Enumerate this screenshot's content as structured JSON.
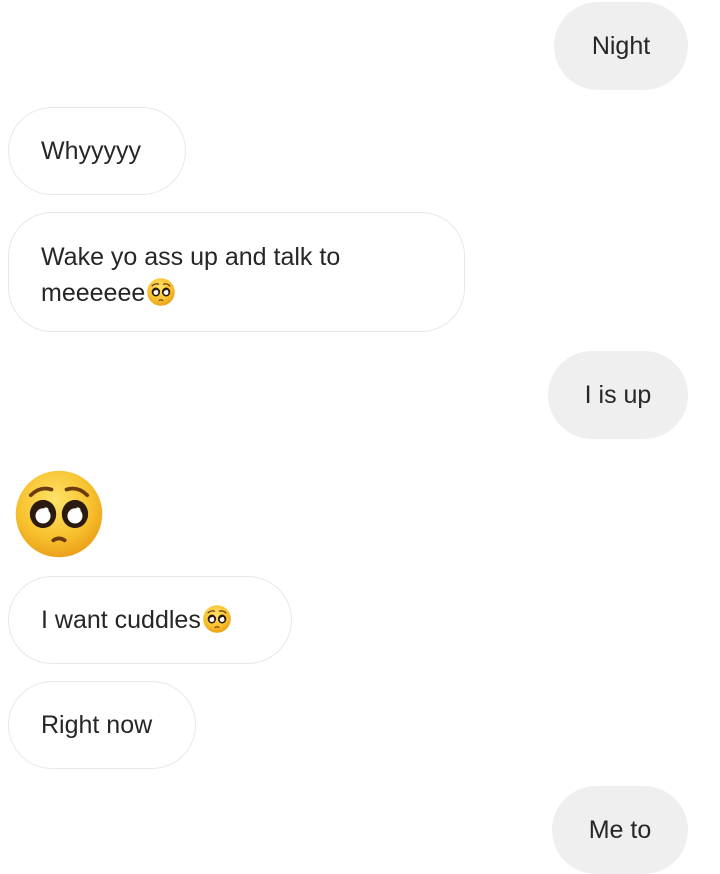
{
  "conversation": {
    "messages": [
      {
        "side": "sent",
        "text": "Night"
      },
      {
        "side": "received",
        "text": "Whyyyyy"
      },
      {
        "side": "received",
        "text": "Wake yo ass up and talk to meeeeee",
        "emoji": "pleading-face-icon"
      },
      {
        "side": "sent",
        "text": "I is up"
      },
      {
        "side": "received",
        "emoji_only": "pleading-face-icon"
      },
      {
        "side": "received",
        "text": "I want cuddles",
        "emoji": "pleading-face-icon"
      },
      {
        "side": "received",
        "text": "Right now"
      },
      {
        "side": "sent",
        "text": "Me to"
      }
    ]
  },
  "colors": {
    "sent_bubble": "#efefef",
    "received_border": "#e8e8e8",
    "text": "#262626",
    "emoji_face": "#f7c02c"
  }
}
